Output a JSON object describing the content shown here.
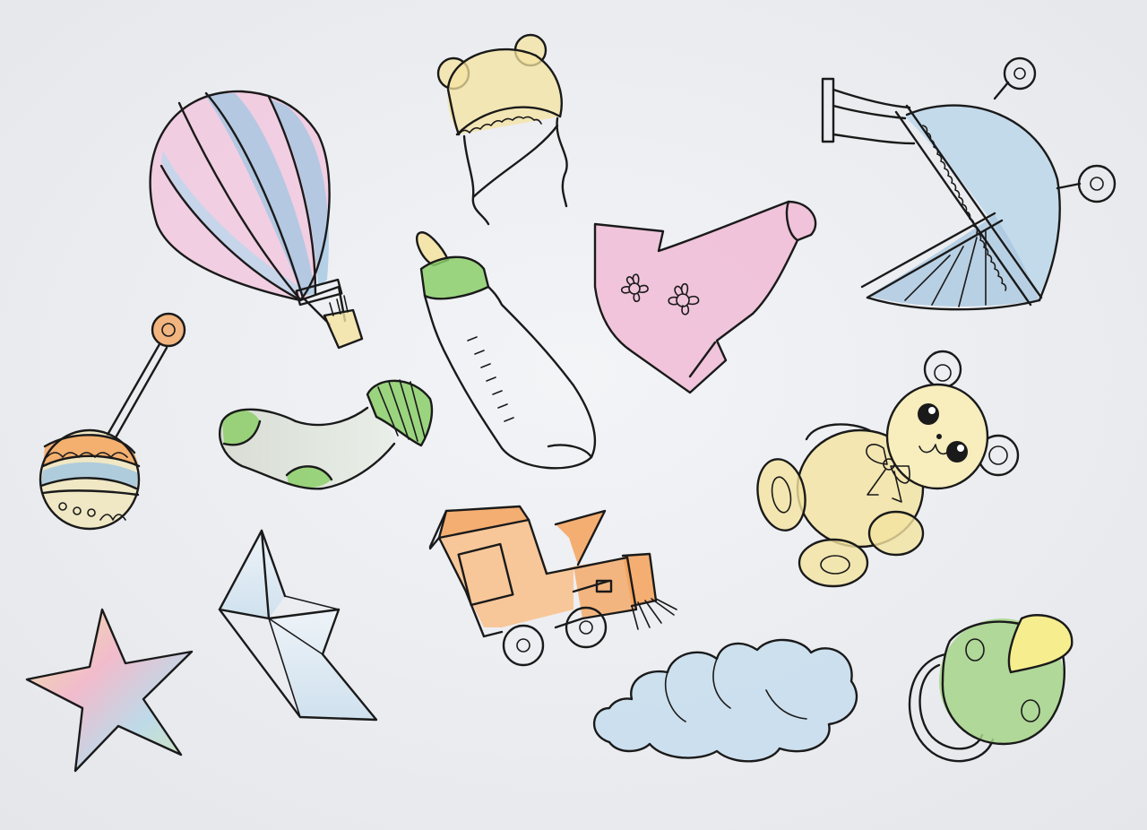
{
  "scene": {
    "palette": {
      "paper": "#eeeff3",
      "ink": "#1a1a1a",
      "blue": "#9fc6e2",
      "pink": "#f0b4d2",
      "yellow": "#f4e3a0",
      "green": "#8ccf6a",
      "orange": "#f4a25a",
      "grey": "#d9ddd7"
    },
    "items": [
      "hot-air-balloon",
      "baby-bonnet",
      "baby-bottle",
      "baby-romper",
      "baby-stroller",
      "baby-rattle",
      "baby-sock",
      "teddy-bear",
      "toy-train",
      "paper-boat",
      "star",
      "cloud",
      "pacifier"
    ]
  }
}
